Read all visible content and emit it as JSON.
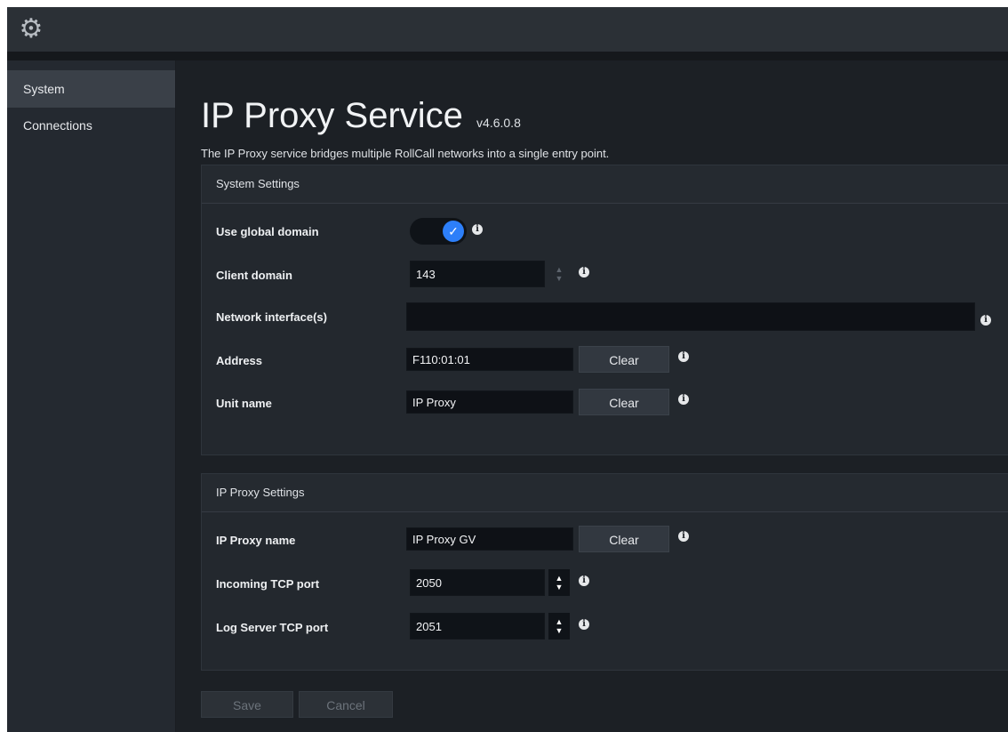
{
  "topbar": {
    "icon": "gear-icon"
  },
  "sidebar": {
    "items": [
      {
        "label": "System"
      },
      {
        "label": "Connections"
      }
    ]
  },
  "header": {
    "title": "IP Proxy Service",
    "version": "v4.6.0.8",
    "subtitle": "The IP Proxy service bridges multiple RollCall networks into a single entry point."
  },
  "system_settings": {
    "header": "System Settings",
    "use_global_domain": {
      "label": "Use global domain",
      "checked": true
    },
    "client_domain": {
      "label": "Client domain",
      "value": "143"
    },
    "network_interfaces": {
      "label": "Network interface(s)",
      "value": ""
    },
    "address": {
      "label": "Address",
      "value": "F110:01:01",
      "clear_label": "Clear"
    },
    "unit_name": {
      "label": "Unit name",
      "value": "IP Proxy",
      "clear_label": "Clear"
    }
  },
  "proxy_settings": {
    "header": "IP Proxy Settings",
    "proxy_name": {
      "label": "IP Proxy name",
      "value": "IP Proxy GV",
      "clear_label": "Clear"
    },
    "incoming_port": {
      "label": "Incoming TCP port",
      "value": "2050"
    },
    "log_port": {
      "label": "Log Server TCP port",
      "value": "2051"
    }
  },
  "footer": {
    "save_label": "Save",
    "cancel_label": "Cancel"
  },
  "colors": {
    "accent": "#2d7ff9",
    "background": "#1c2025",
    "panel": "#23282e"
  }
}
